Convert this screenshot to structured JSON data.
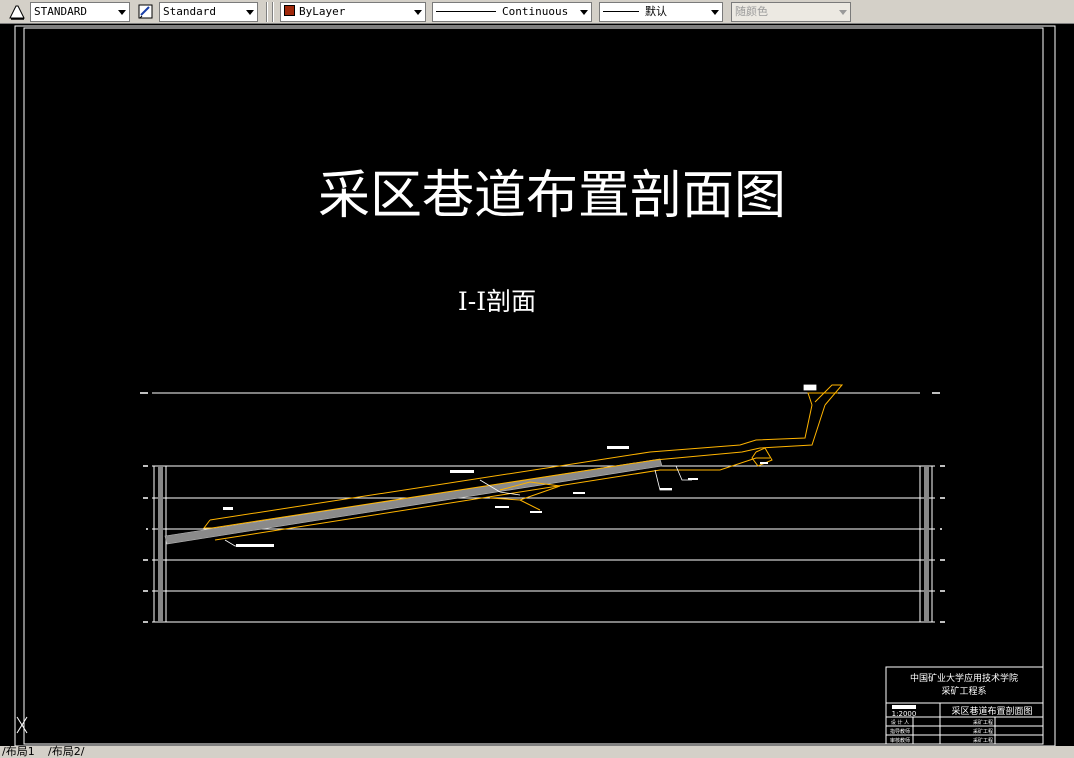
{
  "toolbar": {
    "text_style": "STANDARD",
    "dim_style": "Standard",
    "layer": "ByLayer",
    "linetype": "Continuous",
    "lineweight": "默认",
    "plot_style": "随颜色",
    "layer_color": "#a0280a"
  },
  "drawing": {
    "title": "采区巷道布置剖面图",
    "section_label": "I-I剖面",
    "colors": {
      "background": "#000000",
      "line": "#ffffff",
      "roadway": "#ffb400",
      "seam": "#888888"
    }
  },
  "title_block": {
    "school": "中国矿业大学应用技术学院",
    "department": "采矿工程系",
    "drawing_name": "采区巷道布置剖面图",
    "scale": "1:2000",
    "rows": [
      {
        "left": "设  计  人",
        "right": "采矿工程"
      },
      {
        "left": "指导教师",
        "right": "采矿工程"
      },
      {
        "left": "审核教师",
        "right": "采矿工程"
      }
    ]
  },
  "tabs": {
    "layout1": "布局1",
    "layout2": "布局2"
  }
}
